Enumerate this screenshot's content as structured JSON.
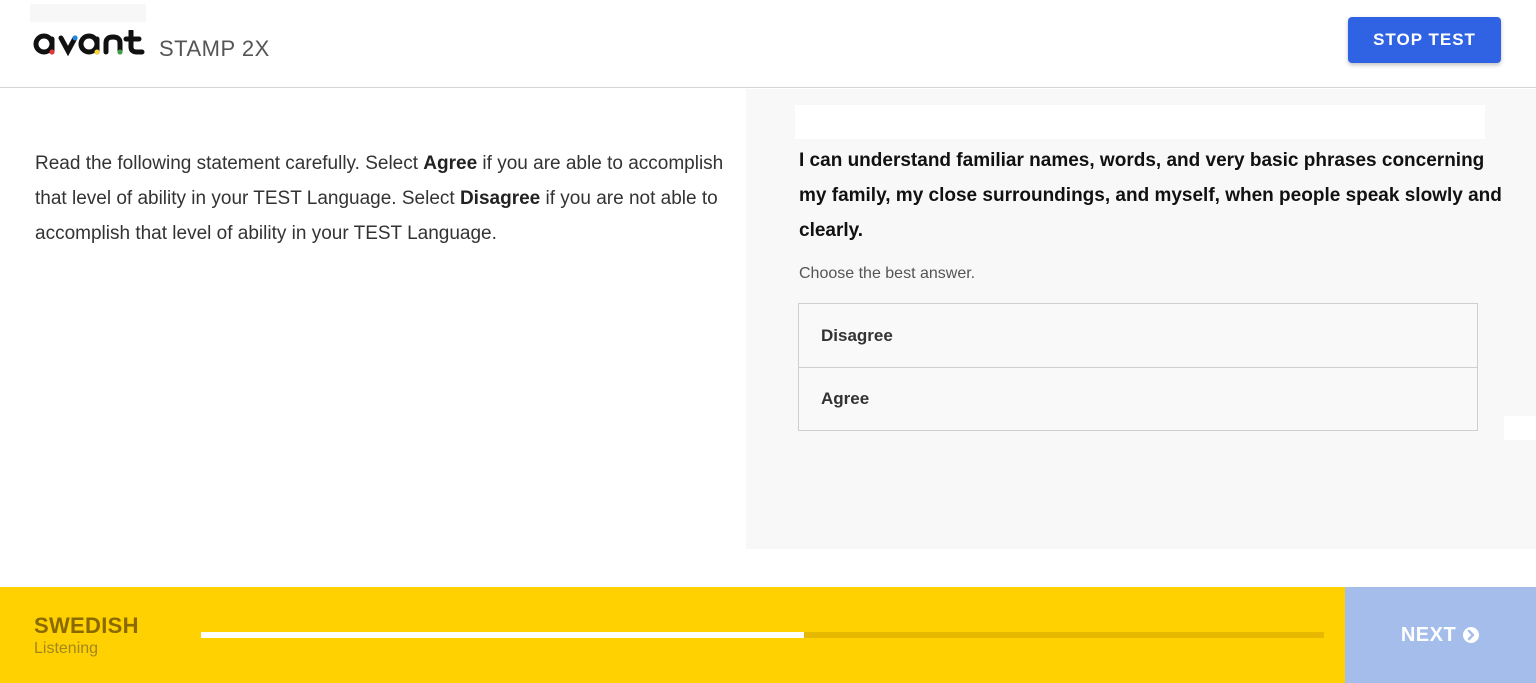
{
  "header": {
    "logo_text": "avant",
    "product": "STAMP 2X",
    "stop_label": "STOP TEST"
  },
  "instructions": {
    "part1": "Read the following statement carefully. Select ",
    "agree_word": "Agree",
    "part2": " if you are able to accomplish that level of ability in your TEST Language. Select ",
    "disagree_word": "Disagree",
    "part3": " if you are not able to accomplish that level of ability in your TEST Language."
  },
  "question": {
    "statement": "I can understand familiar names, words, and very basic phrases concerning my family, my close surroundings, and myself, when people speak slowly and clearly.",
    "prompt": "Choose the best answer.",
    "options": [
      {
        "label": "Disagree"
      },
      {
        "label": "Agree"
      }
    ]
  },
  "footer": {
    "language": "SWEDISH",
    "skill": "Listening",
    "progress_fraction": 0.537,
    "next_label": "NEXT"
  },
  "colors": {
    "accent_blue": "#2f63e3",
    "footer_yellow": "#ffd100",
    "next_disabled": "#a5bdea"
  },
  "icons": {
    "next": "chevron-circle-right-icon"
  }
}
